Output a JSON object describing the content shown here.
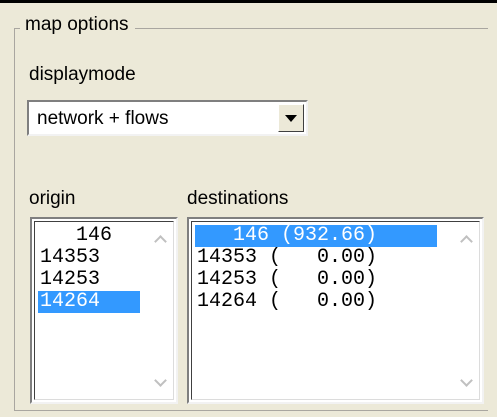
{
  "group": {
    "title": "map options"
  },
  "displaymode": {
    "label": "displaymode",
    "selected": "network + flows"
  },
  "origin": {
    "label": "origin",
    "items": [
      {
        "text": "   146",
        "selected": false
      },
      {
        "text": "14353",
        "selected": false
      },
      {
        "text": "14253",
        "selected": false
      },
      {
        "text": "14264",
        "selected": true
      }
    ]
  },
  "destinations": {
    "label": "destinations",
    "items": [
      {
        "text": "   146 (932.66)",
        "selected": true
      },
      {
        "text": "14353 (   0.00)",
        "selected": false
      },
      {
        "text": "14253 (   0.00)",
        "selected": false
      },
      {
        "text": "14264 (   0.00)",
        "selected": false
      }
    ]
  },
  "colors": {
    "selection": "#3399ff",
    "background": "#ece9d8"
  }
}
